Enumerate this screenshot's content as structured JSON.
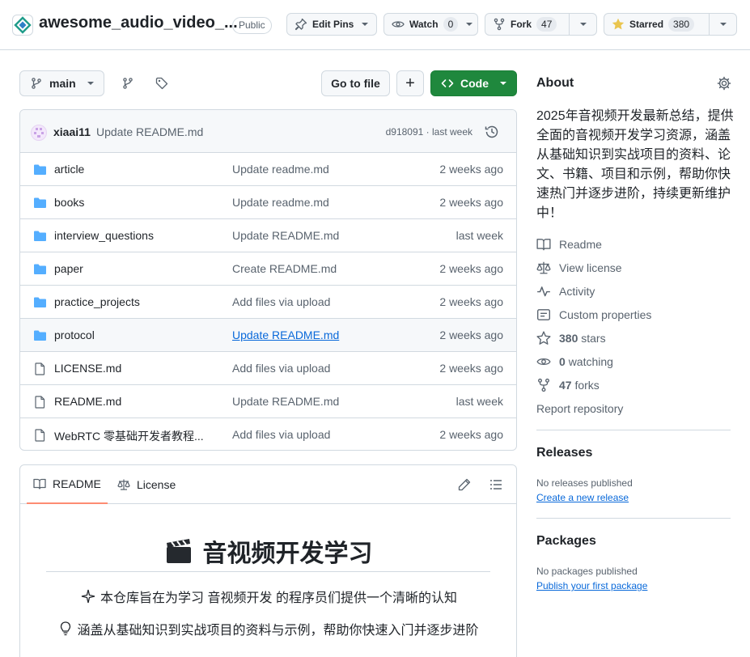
{
  "repo": {
    "name": "awesome_audio_video_...",
    "visibility": "Public",
    "edit_pins_label": "Edit Pins",
    "watch_label": "Watch",
    "watch_count": "0",
    "fork_label": "Fork",
    "fork_count": "47",
    "star_label": "Starred",
    "star_count": "380"
  },
  "toolbar": {
    "branch": "main",
    "go_to_file": "Go to file",
    "add_label": "+",
    "code_label": "Code"
  },
  "latest_commit": {
    "author": "xiaai11",
    "message": "Update README.md",
    "meta": "d918091 · last week"
  },
  "files": [
    {
      "type": "folder",
      "name": "article",
      "commit": "Update readme.md",
      "time": "2 weeks ago"
    },
    {
      "type": "folder",
      "name": "books",
      "commit": "Update readme.md",
      "time": "2 weeks ago"
    },
    {
      "type": "folder",
      "name": "interview_questions",
      "commit": "Update README.md",
      "time": "last week"
    },
    {
      "type": "folder",
      "name": "paper",
      "commit": "Create README.md",
      "time": "2 weeks ago"
    },
    {
      "type": "folder",
      "name": "practice_projects",
      "commit": "Add files via upload",
      "time": "2 weeks ago"
    },
    {
      "type": "folder",
      "name": "protocol",
      "commit": "Update README.md",
      "time": "2 weeks ago"
    },
    {
      "type": "file",
      "name": "LICENSE.md",
      "commit": "Add files via upload",
      "time": "2 weeks ago"
    },
    {
      "type": "file",
      "name": "README.md",
      "commit": "Update README.md",
      "time": "last week"
    },
    {
      "type": "file",
      "name": "WebRTC 零基础开发者教程...",
      "commit": "Add files via upload",
      "time": "2 weeks ago"
    }
  ],
  "readme": {
    "tab_readme": "README",
    "tab_license": "License",
    "heading": "音视频开发学习",
    "line1": "本仓库旨在为学习 音视频开发 的程序员们提供一个清晰的认知",
    "line2": "涵盖从基础知识到实战项目的资料与示例，帮助你快速入门并逐步进阶"
  },
  "about": {
    "title": "About",
    "description": "2025年音视频开发最新总结，提供全面的音视频开发学习资源，涵盖从基础知识到实战项目的资料、论文、书籍、项目和示例，帮助你快速热门并逐步进阶，持续更新维护中！",
    "readme": "Readme",
    "license": "View license",
    "activity": "Activity",
    "custom_properties": "Custom properties",
    "stars_count": "380",
    "stars_label": "stars",
    "watching_count": "0",
    "watching_label": "watching",
    "forks_count": "47",
    "forks_label": "forks",
    "report": "Report repository"
  },
  "releases": {
    "title": "Releases",
    "empty": "No releases published",
    "link": "Create a new release"
  },
  "packages": {
    "title": "Packages",
    "empty": "No packages published",
    "link": "Publish your first package"
  },
  "colors": {
    "accent_green": "#1f883d",
    "link_blue": "#0969da",
    "folder_blue": "#54aeff",
    "tab_underline": "#fd8c73"
  }
}
